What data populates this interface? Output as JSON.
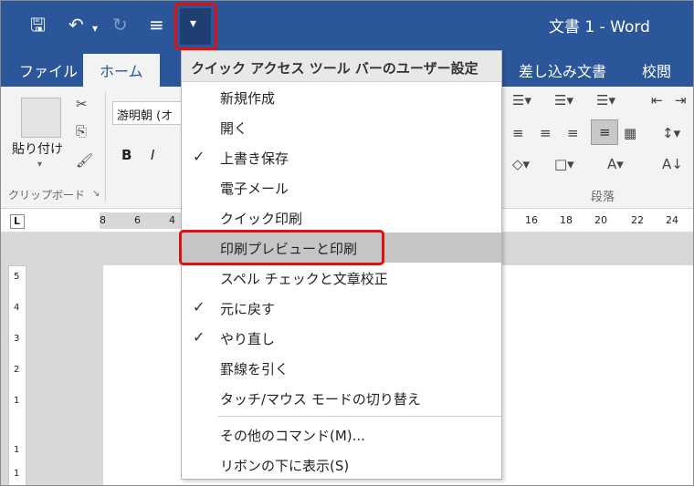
{
  "window": {
    "title": "文書 1 - Word"
  },
  "qat": {
    "save": "🖫",
    "undo": "↶",
    "undo_arrow": "▾",
    "redo": "↻",
    "touch": "≡",
    "customize": "▾"
  },
  "tabs": [
    "ファイル",
    "ホーム",
    "差し込み文書",
    "校閲"
  ],
  "ribbon": {
    "paste_label": "貼り付け",
    "paste_arrow": "▾",
    "clipboard_group": "クリップボード",
    "clipboard_launcher": "↘",
    "font_name": "游明朝 (オ",
    "bold": "B",
    "italic": "I",
    "paragraph_group": "段落"
  },
  "ruler": {
    "tab_selector": "L",
    "left_marks": [
      "8",
      "6",
      "4"
    ],
    "right_marks": [
      "16",
      "18",
      "20",
      "22",
      "24"
    ]
  },
  "vruler": {
    "marks": [
      "5",
      "4",
      "3",
      "2",
      "1",
      "1",
      "1"
    ]
  },
  "menu": {
    "header": "クイック アクセス ツール バーのユーザー設定",
    "items": [
      {
        "label": "新規作成",
        "checked": false
      },
      {
        "label": "開く",
        "checked": false
      },
      {
        "label": "上書き保存",
        "checked": true
      },
      {
        "label": "電子メール",
        "checked": false
      },
      {
        "label": "クイック印刷",
        "checked": false
      },
      {
        "label": "印刷プレビューと印刷",
        "checked": false,
        "highlighted": true
      },
      {
        "label": "スペル チェックと文章校正",
        "checked": false
      },
      {
        "label": "元に戻す",
        "checked": true
      },
      {
        "label": "やり直し",
        "checked": true
      },
      {
        "label": "罫線を引く",
        "checked": false
      },
      {
        "label": "タッチ/マウス モードの切り替え",
        "checked": false
      },
      {
        "label": "その他のコマンド(M)...",
        "checked": false
      },
      {
        "label": "リボンの下に表示(S)",
        "checked": false
      }
    ],
    "check_glyph": "✓"
  },
  "colors": {
    "word_blue": "#2b579a",
    "highlight_red": "#e01010"
  }
}
